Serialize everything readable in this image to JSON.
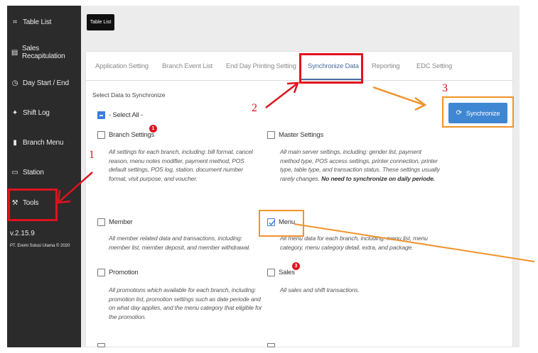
{
  "sidebar": {
    "items": [
      {
        "label": "Table List",
        "icon": "table-icon"
      },
      {
        "label": "Sales Recapitulation",
        "icon": "report-icon"
      },
      {
        "label": "Day Start / End",
        "icon": "clock-icon"
      },
      {
        "label": "Shift Log",
        "icon": "shift-icon"
      },
      {
        "label": "Branch Menu",
        "icon": "book-icon"
      },
      {
        "label": "Station",
        "icon": "monitor-icon"
      },
      {
        "label": "Tools",
        "icon": "wrench-icon"
      }
    ],
    "version": "v.2.15.9",
    "copyright": "PT. Eremi Solusi Utama © 2020"
  },
  "header": {
    "title": "Table List"
  },
  "tabs": [
    {
      "label": "Application Setting"
    },
    {
      "label": "Branch Event List"
    },
    {
      "label": "End Day Printing Setting"
    },
    {
      "label": "Synchronize Data"
    },
    {
      "label": "Reporting"
    },
    {
      "label": "EDC Setting"
    }
  ],
  "section": {
    "label": "Select Data to Synchronize",
    "select_all": "- Select All -"
  },
  "options": {
    "branch_settings": {
      "label": "Branch Settings",
      "desc": "All settings for each branch, including: bill format, cancel reason, menu notes modifier, payment method, POS default settings, POS log, station, document number format, visit purpose, and voucher."
    },
    "master_settings": {
      "label": "Master Settings",
      "desc": "All main server settings, including: gender list, payment method type, POS access settings, printer connection, printer type, table type, and transaction status. These settings usually rarely changes.",
      "desc_strong": "No need to synchronize on daily periode."
    },
    "member": {
      "label": "Member",
      "desc": "All member related data and transactions, including: member list, member deposit, and member withdrawal."
    },
    "menu": {
      "label": "Menu",
      "desc": "All menu data for each branch, including: menu list, menu category, menu category detail, extra, and package."
    },
    "promotion": {
      "label": "Promotion",
      "desc": "All promotions which available for each branch, including: promotion list, promotion settings such as date periode and on what day applies, and the menu category that eligible for the promotion."
    },
    "sales": {
      "label": "Sales",
      "desc": "All sales and shift transactions."
    }
  },
  "badges": {
    "branch": "1",
    "sales": "3"
  },
  "synchronize_button": "Synchronize",
  "annotations": {
    "n1": "1",
    "n2": "2",
    "n3": "3"
  },
  "colors": {
    "sidebar": "#2b2b2b",
    "primary": "#3f87d3",
    "highlight_red": "#e0121e",
    "highlight_orange": "#f0932b"
  }
}
